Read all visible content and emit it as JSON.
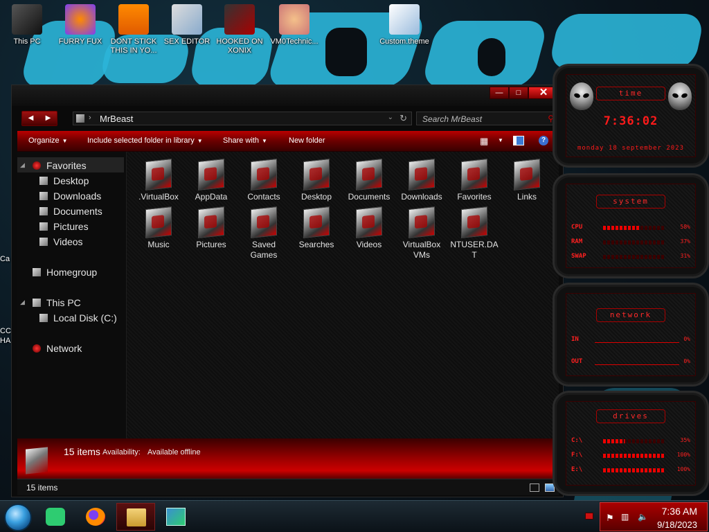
{
  "desktop": {
    "icons": [
      {
        "label": "This PC",
        "icon": "computer-icon",
        "lines": [
          "This PC"
        ]
      },
      {
        "label": "FURRY FUX",
        "icon": "firefox-shortcut-icon",
        "lines": [
          "FURRY FUX"
        ]
      },
      {
        "label": "DONT STICK THIS IN YO...",
        "icon": "vlc-shortcut-icon",
        "lines": [
          "DONT STICK",
          "THIS IN YO..."
        ]
      },
      {
        "label": "SEX EDITOR",
        "icon": "hxd-shortcut-icon",
        "lines": [
          "SEX EDITOR"
        ]
      },
      {
        "label": "HOOKED ON XONIX",
        "icon": "game-shortcut-icon",
        "lines": [
          "HOOKED ON",
          "XONIX"
        ]
      },
      {
        "label": "VM0Technic...",
        "icon": "doctor-icon",
        "lines": [
          "VM0Technic..."
        ]
      },
      {
        "label": "Custom.theme",
        "icon": "theme-file-icon",
        "lines": [
          "Custom.theme"
        ]
      }
    ],
    "edge_fragments": [
      "Ca",
      "CC",
      "HA"
    ]
  },
  "window": {
    "title_buttons": {
      "minimize": "—",
      "maximize": "□",
      "close": "✕"
    },
    "nav": {
      "back": "◀",
      "forward": "▶"
    },
    "address": {
      "separator": "›",
      "path": "MrBeast",
      "dropdown": "⌄",
      "refresh": "↻"
    },
    "search": {
      "placeholder": "Search MrBeast",
      "icon": "⚲"
    },
    "commands": [
      {
        "label": "Organize",
        "has_arrow": true
      },
      {
        "label": "Include selected folder in library",
        "has_arrow": true
      },
      {
        "label": "Share with",
        "has_arrow": true
      },
      {
        "label": "New folder",
        "has_arrow": false
      }
    ],
    "nav_pane": {
      "favorites": "Favorites",
      "fav_items": [
        "Desktop",
        "Downloads",
        "Documents",
        "Pictures",
        "Videos"
      ],
      "homegroup": "Homegroup",
      "this_pc": "This PC",
      "drives": [
        "Local Disk (C:)"
      ],
      "network": "Network"
    },
    "items": [
      {
        "lines": [
          ".VirtualBox"
        ]
      },
      {
        "lines": [
          "AppData"
        ]
      },
      {
        "lines": [
          "Contacts"
        ]
      },
      {
        "lines": [
          "Desktop"
        ]
      },
      {
        "lines": [
          "Documents"
        ]
      },
      {
        "lines": [
          "Downloads"
        ]
      },
      {
        "lines": [
          "Favorites"
        ]
      },
      {
        "lines": [
          "Links"
        ]
      },
      {
        "lines": [
          "Music"
        ]
      },
      {
        "lines": [
          "Pictures"
        ]
      },
      {
        "lines": [
          "Saved",
          "Games"
        ]
      },
      {
        "lines": [
          "Searches"
        ]
      },
      {
        "lines": [
          "Videos"
        ]
      },
      {
        "lines": [
          "VirtualBox",
          "VMs"
        ]
      },
      {
        "lines": [
          "NTUSER.DA",
          "T"
        ]
      }
    ],
    "details": {
      "count": "15 items",
      "availability_label": "Availability:",
      "availability_value": "Available offline"
    },
    "status": {
      "count": "15 items"
    }
  },
  "gadgets": {
    "time": {
      "title": "time",
      "clock": "7:36:02",
      "date": "monday 18 september 2023"
    },
    "system": {
      "title": "system",
      "rows": [
        {
          "label": "CPU",
          "value": "58%",
          "fill": 0.58
        },
        {
          "label": "RAM",
          "value": "37%",
          "fill": 0.37
        },
        {
          "label": "SWAP",
          "value": "31%",
          "fill": 0.31
        }
      ]
    },
    "network": {
      "title": "network",
      "rows": [
        {
          "label": "IN",
          "value": "0%"
        },
        {
          "label": "OUT",
          "value": "0%"
        }
      ]
    },
    "drives": {
      "title": "drives",
      "rows": [
        {
          "label": "C:\\",
          "value": "35%",
          "fill": 0.35
        },
        {
          "label": "F:\\",
          "value": "100%",
          "fill": 1.0
        },
        {
          "label": "E:\\",
          "value": "100%",
          "fill": 1.0
        }
      ]
    },
    "accent": "#ff1a1a"
  },
  "taskbar": {
    "buttons": [
      "start-orb",
      "notepad",
      "firefox",
      "file-explorer",
      "virtualbox-manager"
    ],
    "tray": {
      "time": "7:36 AM",
      "date": "9/18/2023"
    }
  }
}
